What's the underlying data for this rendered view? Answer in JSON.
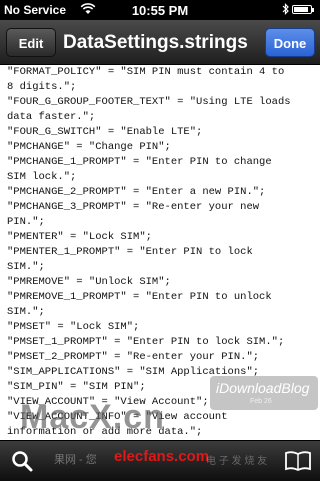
{
  "status_bar": {
    "carrier": "No Service",
    "time": "10:55 PM",
    "battery_level": 0.9,
    "wifi_icon": "wifi-icon",
    "bluetooth_icon": "bluetooth-icon"
  },
  "nav_bar": {
    "edit_label": "Edit",
    "title": "DataSettings.strings",
    "done_label": "Done",
    "done_color": "#2a63d6"
  },
  "content": {
    "lines": [
      "\"FORMAT_POLICY\" = \"SIM PIN must contain 4 to",
      "8 digits.\";",
      "\"FOUR_G_GROUP_FOOTER_TEXT\" = \"Using LTE loads",
      "data faster.\";",
      "\"FOUR_G_SWITCH\" = \"Enable LTE\";",
      "\"PMCHANGE\" = \"Change PIN\";",
      "\"PMCHANGE_1_PROMPT\" = \"Enter PIN to change",
      "SIM lock.\";",
      "\"PMCHANGE_2_PROMPT\" = \"Enter a new PIN.\";",
      "\"PMCHANGE_3_PROMPT\" = \"Re-enter your new",
      "PIN.\";",
      "\"PMENTER\" = \"Lock SIM\";",
      "\"PMENTER_1_PROMPT\" = \"Enter PIN to lock",
      "SIM.\";",
      "\"PMREMOVE\" = \"Unlock SIM\";",
      "\"PMREMOVE_1_PROMPT\" = \"Enter PIN to unlock",
      "SIM.\";",
      "\"PMSET\" = \"Lock SIM\";",
      "\"PMSET_1_PROMPT\" = \"Enter PIN to lock SIM.\";",
      "\"PMSET_2_PROMPT\" = \"Re-enter your PIN.\";",
      "\"SIM_APPLICATIONS\" = \"SIM Applications\";",
      "\"SIM_PIN\" = \"SIM PIN\";",
      "\"VIEW_ACCOUNT\" = \"View Account\";",
      "\"VIEW_ACCOUNT_INFO\" = \"View account",
      "information or add more data.\";"
    ]
  },
  "watermark": {
    "label": "iDownloadBlog",
    "date": "Feb 26"
  },
  "toolbar": {
    "search_icon": "search-icon",
    "book_icon": "book-icon"
  },
  "overlays": {
    "macx": "MacX.cn",
    "elecfans": "elecfans.com",
    "faint_left": "果网 - 您",
    "faint_right": "电 子 发 烧 友"
  }
}
